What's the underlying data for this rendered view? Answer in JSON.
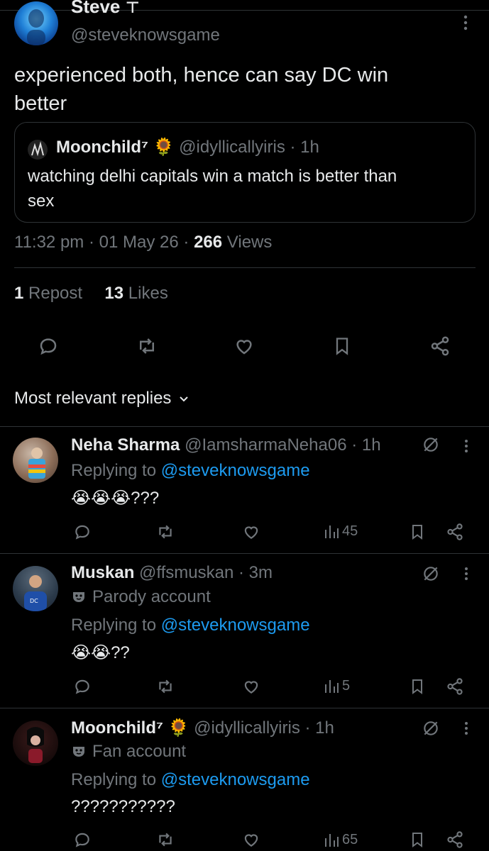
{
  "tweet": {
    "author_name": "Steve",
    "author_handle": "@steveknowsgame",
    "text_line1": "experienced both, hence can say DC win",
    "text_line2": "better",
    "quote": {
      "name": "Moonchild⁷",
      "emoji": "🌻",
      "handle": "@idyllicallyiris",
      "time": "· 1h",
      "text_line1": "watching delhi capitals win a match is better than",
      "text_line2": "sex"
    },
    "time": "11:32 pm",
    "date": "01 May 26",
    "views_count": "266",
    "views_label": "Views",
    "sep": "·",
    "repost_count": "1",
    "repost_label": "Repost",
    "likes_count": "13",
    "likes_label": "Likes"
  },
  "sort": {
    "label": "Most relevant replies"
  },
  "replies": [
    {
      "name": "Neha Sharma",
      "handle": "@IamsharmaNeha06",
      "time": "· 1h",
      "badge": "",
      "replying_prefix": "Replying to",
      "replying_handle": "@steveknowsgame",
      "text": "😭😭😭???",
      "views": "45"
    },
    {
      "name": "Muskan",
      "handle": "@ffsmuskan",
      "time": "· 3m",
      "badge": "Parody account",
      "replying_prefix": "Replying to",
      "replying_handle": "@steveknowsgame",
      "text": "😭😭??",
      "views": "5"
    },
    {
      "name": "Moonchild⁷",
      "emoji": "🌻",
      "handle": "@idyllicallyiris",
      "time": "· 1h",
      "badge": "Fan account",
      "replying_prefix": "Replying to",
      "replying_handle": "@steveknowsgame",
      "text": "???????????",
      "views": "65"
    }
  ],
  "colors": {
    "accent": "#1d9bf0",
    "muted": "#71767b",
    "divider": "#2f3336",
    "background": "#000000"
  }
}
